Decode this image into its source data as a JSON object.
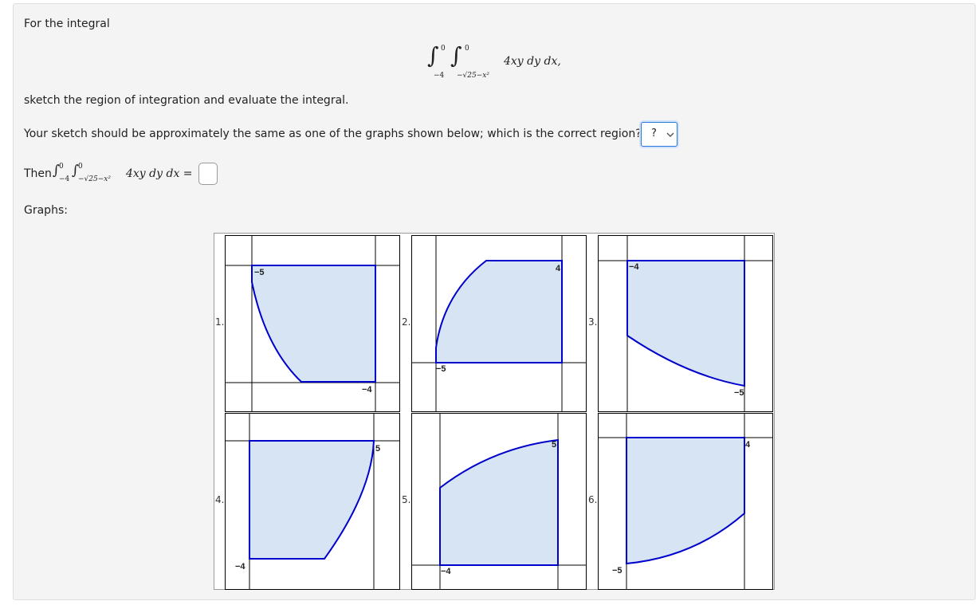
{
  "question": {
    "intro": "For the integral",
    "integral": {
      "outer_upper": "0",
      "outer_lower": "−4",
      "inner_upper": "0",
      "inner_lower": "−√25−x²",
      "integrand": "4xy dy dx,"
    },
    "sketch_text": "sketch the region of integration and evaluate the integral.",
    "select_prompt": "Your sketch should be approximately the same as one of the graphs shown below; which is the correct region? Graph",
    "select_value": "?",
    "then_label": "Then",
    "then_expr": "4xy dy dx =",
    "answer_value": "",
    "graphs_label": "Graphs:"
  },
  "graphs": [
    {
      "number": "1.",
      "labels": [
        "−5",
        "−4"
      ]
    },
    {
      "number": "2.",
      "labels": [
        "4",
        "−5"
      ]
    },
    {
      "number": "3.",
      "labels": [
        "−4",
        "−5"
      ]
    },
    {
      "number": "4.",
      "labels": [
        "5",
        "−4"
      ]
    },
    {
      "number": "5.",
      "labels": [
        "5",
        "−4"
      ]
    },
    {
      "number": "6.",
      "labels": [
        "4",
        "−5"
      ]
    }
  ],
  "colors": {
    "region_fill": "#d6e4f4",
    "region_stroke": "#0000cc",
    "select_border": "#2a79d6"
  }
}
